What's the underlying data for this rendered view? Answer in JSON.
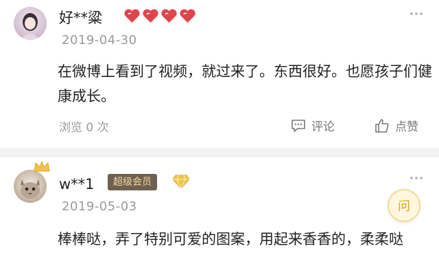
{
  "comments": [
    {
      "username": "好**粱",
      "date": "2019-04-30",
      "text": "在微博上看到了视频，就过来了。东西很好。也愿孩子们健康成长。",
      "views": "浏览 0 次",
      "comment_label": "评论",
      "like_label": "点赞",
      "heart_rating": 4,
      "avatar_icon": "avatar-girl-icon"
    },
    {
      "username": "w**1",
      "badge": "超级会员",
      "date": "2019-05-03",
      "text": "棒棒哒，弄了特别可爱的图案，用起来香香的，柔柔哒",
      "avatar_icon": "avatar-cat-icon"
    }
  ],
  "float_button": {
    "label": "问"
  },
  "colors": {
    "heart": "#e0454d",
    "badge_bg": "#6f6150",
    "badge_text": "#f3d9a6",
    "diamond": "#f0c34a",
    "float_accent": "#d9a520"
  }
}
